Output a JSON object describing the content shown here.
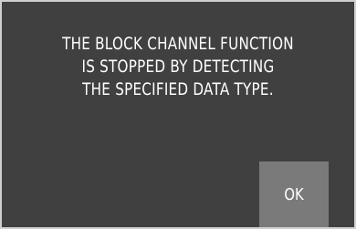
{
  "dialog": {
    "message": "THE BLOCK CHANNEL FUNCTION\nIS STOPPED BY DETECTING\nTHE SPECIFIED DATA TYPE.",
    "ok_label": "OK"
  },
  "colors": {
    "background": "#404040",
    "border": "#cfcfcf",
    "button": "#7a7a7a",
    "text": "#ffffff"
  }
}
